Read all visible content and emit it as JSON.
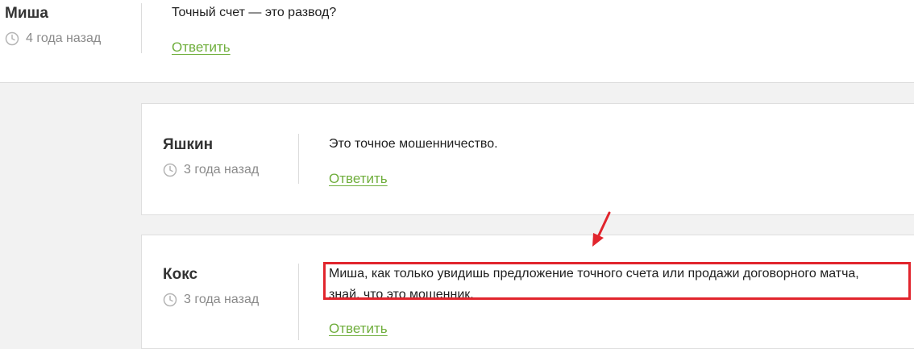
{
  "comments": [
    {
      "author": "Миша",
      "time": "4 года назад",
      "text": "Точный счет — это развод?",
      "reply_label": "Ответить"
    },
    {
      "author": "Яшкин",
      "time": "3 года назад",
      "text": "Это точное мошенничество.",
      "reply_label": "Ответить"
    },
    {
      "author": "Кокс",
      "time": "3 года назад",
      "text_line1": "Миша, как только увидишь предложение точного счета или продажи договорного матча,",
      "text_line2": "знай, что это мошенник.",
      "reply_label": "Ответить"
    }
  ],
  "icons": {
    "clock": "clock-icon",
    "arrow": "arrow-down-left-icon"
  },
  "colors": {
    "link": "#6fae3c",
    "highlight": "#e1252d",
    "muted": "#8a8a8a"
  }
}
